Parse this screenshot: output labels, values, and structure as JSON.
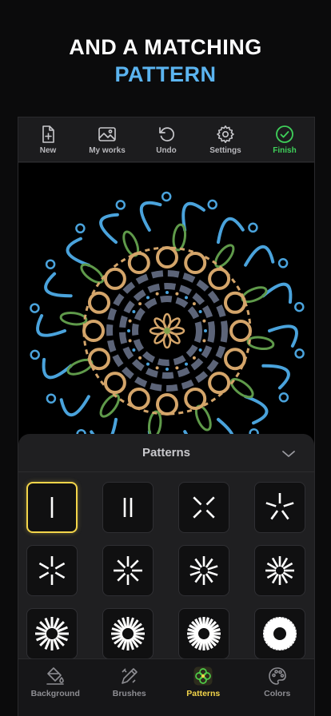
{
  "headline": {
    "line1": "AND A MATCHING",
    "line2": "PATTERN"
  },
  "toolbar": {
    "new": "New",
    "my_works": "My works",
    "undo": "Undo",
    "settings": "Settings",
    "finish": "Finish"
  },
  "sheet": {
    "title": "Patterns",
    "selected_index": 0,
    "patterns": [
      {
        "rays": 1
      },
      {
        "rays": 2
      },
      {
        "rays": 4
      },
      {
        "rays": 5
      },
      {
        "rays": 6
      },
      {
        "rays": 8
      },
      {
        "rays": 10
      },
      {
        "rays": 12
      },
      {
        "rays": 16
      },
      {
        "rays": 20
      },
      {
        "rays": 24
      },
      {
        "rays": 32
      }
    ]
  },
  "bottom_nav": {
    "background": "Background",
    "brushes": "Brushes",
    "patterns": "Patterns",
    "colors": "Colors",
    "active": "Patterns"
  },
  "colors": {
    "accent": "#f3d54a",
    "finish": "#3fd05a",
    "headline_blue": "#5bb4f0"
  }
}
